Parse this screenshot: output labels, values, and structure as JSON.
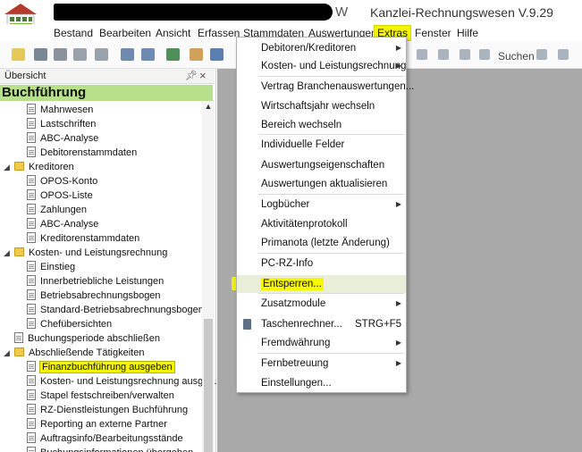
{
  "window": {
    "title_suffix": "W",
    "title": "Kanzlei-Rechnungswesen V.9.29"
  },
  "menubar": {
    "items": [
      "Bestand",
      "Bearbeiten",
      "Ansicht",
      "Erfassen",
      "Stammdaten",
      "Auswertungen",
      "Extras",
      "Fenster",
      "Hilfe"
    ],
    "active": "Extras"
  },
  "toolbar": {
    "search_label": "Suchen"
  },
  "panel": {
    "header": "Übersicht",
    "pin_icon": "pin-icon",
    "close_icon": "close-icon",
    "title": "Buchführung",
    "tree": [
      {
        "label": "Mahnwesen",
        "type": "doc",
        "level": 2
      },
      {
        "label": "Lastschriften",
        "type": "doc",
        "level": 2
      },
      {
        "label": "ABC-Analyse",
        "type": "doc",
        "level": 2
      },
      {
        "label": "Debitorenstammdaten",
        "type": "doc",
        "level": 2
      },
      {
        "label": "Kreditoren",
        "type": "folder",
        "level": 1
      },
      {
        "label": "OPOS-Konto",
        "type": "doc",
        "level": 2
      },
      {
        "label": "OPOS-Liste",
        "type": "doc",
        "level": 2
      },
      {
        "label": "Zahlungen",
        "type": "doc",
        "level": 2
      },
      {
        "label": "ABC-Analyse",
        "type": "doc",
        "level": 2
      },
      {
        "label": "Kreditorenstammdaten",
        "type": "doc",
        "level": 2
      },
      {
        "label": "Kosten- und Leistungsrechnung",
        "type": "folder",
        "level": 1
      },
      {
        "label": "Einstieg",
        "type": "doc",
        "level": 2
      },
      {
        "label": "Innerbetriebliche Leistungen",
        "type": "doc",
        "level": 2
      },
      {
        "label": "Betriebsabrechnungsbogen",
        "type": "doc",
        "level": 2
      },
      {
        "label": "Standard-Betriebsabrechnungsbogen",
        "type": "doc",
        "level": 2
      },
      {
        "label": "Chefübersichten",
        "type": "doc",
        "level": 2
      },
      {
        "label": "Buchungsperiode abschließen",
        "type": "doc",
        "level": 1
      },
      {
        "label": "Abschließende Tätigkeiten",
        "type": "folder",
        "level": 1
      },
      {
        "label": "Finanzbuchführung ausgeben",
        "type": "doc",
        "level": 2,
        "selected": true
      },
      {
        "label": "Kosten- und Leistungsrechnung ausge...",
        "type": "doc",
        "level": 2
      },
      {
        "label": "Stapel festschreiben/verwalten",
        "type": "doc",
        "level": 2
      },
      {
        "label": "RZ-Dienstleistungen Buchführung",
        "type": "doc",
        "level": 2
      },
      {
        "label": "Reporting an externe Partner",
        "type": "doc",
        "level": 2
      },
      {
        "label": "Auftragsinfo/Bearbeitungsstände",
        "type": "doc",
        "level": 2
      },
      {
        "label": "Buchungsinformationen übergeben",
        "type": "doc",
        "level": 2
      }
    ]
  },
  "extras_menu": {
    "items": [
      {
        "label": "Debitoren/Kreditoren",
        "submenu": true
      },
      {
        "label": "Kosten- und Leistungsrechnung",
        "submenu": true
      },
      {
        "label": "Vertrag Branchenauswertungen...",
        "submenu": false
      },
      {
        "label": "Wirtschaftsjahr wechseln",
        "submenu": false
      },
      {
        "label": "Bereich wechseln",
        "submenu": false
      },
      {
        "label": "Individuelle Felder",
        "submenu": false
      },
      {
        "label": "Auswertungseigenschaften",
        "submenu": false
      },
      {
        "label": "Auswertungen aktualisieren",
        "submenu": false
      },
      {
        "label": "Logbücher",
        "submenu": true
      },
      {
        "label": "Aktivitätenprotokoll",
        "submenu": false
      },
      {
        "label": "Primanota (letzte Änderung)",
        "submenu": false
      },
      {
        "label": "PC-RZ-Info",
        "submenu": false
      },
      {
        "label": "Entsperren...",
        "submenu": false,
        "highlighted": true
      },
      {
        "label": "Zusatzmodule",
        "submenu": true
      },
      {
        "label": "Taschenrechner...",
        "submenu": false,
        "shortcut": "STRG+F5",
        "icon": "calculator-icon"
      },
      {
        "label": "Fremdwährung",
        "submenu": true
      },
      {
        "label": "Fernbetreuung",
        "submenu": true
      },
      {
        "label": "Einstellungen...",
        "submenu": false
      }
    ]
  },
  "colors": {
    "accent_green": "#b7e08a",
    "highlight_yellow": "#f5f500",
    "workspace_grey": "#a9a9a9"
  }
}
